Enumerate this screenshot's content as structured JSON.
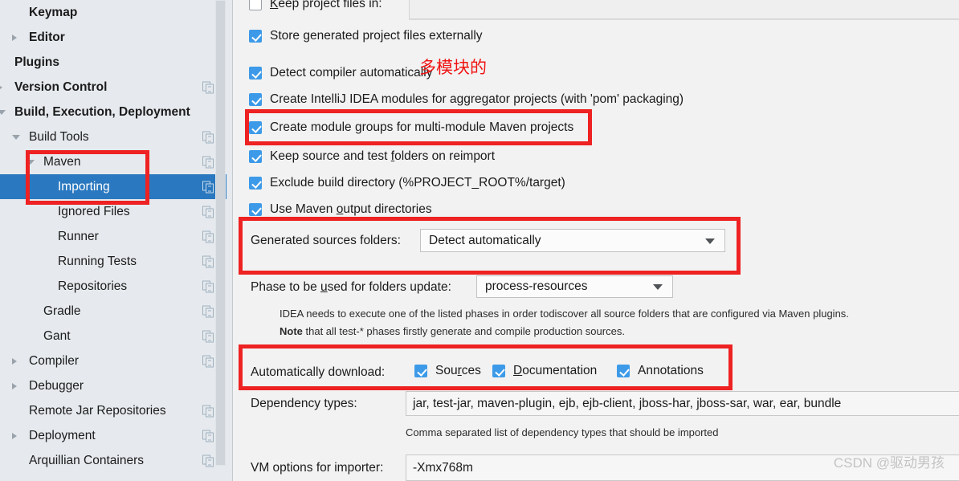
{
  "sidebar": {
    "items": [
      {
        "label": "Keymap",
        "indent": 36,
        "arrow": "none",
        "bold": true,
        "copy": false,
        "selected": false
      },
      {
        "label": "Editor",
        "indent": 36,
        "arrow": "right",
        "bold": true,
        "copy": false,
        "selected": false
      },
      {
        "label": "Plugins",
        "indent": 18,
        "arrow": "none",
        "bold": true,
        "copy": false,
        "selected": false
      },
      {
        "label": "Version Control",
        "indent": 18,
        "arrow": "right",
        "bold": true,
        "copy": true,
        "selected": false
      },
      {
        "label": "Build, Execution, Deployment",
        "indent": 18,
        "arrow": "down",
        "bold": true,
        "copy": false,
        "selected": false
      },
      {
        "label": "Build Tools",
        "indent": 36,
        "arrow": "down",
        "bold": false,
        "copy": true,
        "selected": false
      },
      {
        "label": "Maven",
        "indent": 54,
        "arrow": "down",
        "bold": false,
        "copy": true,
        "selected": false
      },
      {
        "label": "Importing",
        "indent": 72,
        "arrow": "none",
        "bold": false,
        "copy": true,
        "selected": true
      },
      {
        "label": "Ignored Files",
        "indent": 72,
        "arrow": "none",
        "bold": false,
        "copy": true,
        "selected": false
      },
      {
        "label": "Runner",
        "indent": 72,
        "arrow": "none",
        "bold": false,
        "copy": true,
        "selected": false
      },
      {
        "label": "Running Tests",
        "indent": 72,
        "arrow": "none",
        "bold": false,
        "copy": true,
        "selected": false
      },
      {
        "label": "Repositories",
        "indent": 72,
        "arrow": "none",
        "bold": false,
        "copy": true,
        "selected": false
      },
      {
        "label": "Gradle",
        "indent": 54,
        "arrow": "none",
        "bold": false,
        "copy": true,
        "selected": false
      },
      {
        "label": "Gant",
        "indent": 54,
        "arrow": "none",
        "bold": false,
        "copy": true,
        "selected": false
      },
      {
        "label": "Compiler",
        "indent": 36,
        "arrow": "right",
        "bold": false,
        "copy": true,
        "selected": false
      },
      {
        "label": "Debugger",
        "indent": 36,
        "arrow": "right",
        "bold": false,
        "copy": false,
        "selected": false
      },
      {
        "label": "Remote Jar Repositories",
        "indent": 36,
        "arrow": "none",
        "bold": false,
        "copy": true,
        "selected": false
      },
      {
        "label": "Deployment",
        "indent": 36,
        "arrow": "right",
        "bold": false,
        "copy": true,
        "selected": false
      },
      {
        "label": "Arquillian Containers",
        "indent": 36,
        "arrow": "none",
        "bold": false,
        "copy": true,
        "selected": false
      }
    ]
  },
  "content": {
    "keep_project_files": {
      "label_pre": "K",
      "label_underline": "K",
      "label": "Keep project files in:",
      "checked": false,
      "value": ""
    },
    "checkboxes": [
      {
        "label": "Store generated project files externally",
        "checked": true,
        "pre": "Store generated project files externally",
        "u": "",
        "post": ""
      },
      {
        "label": "Detect compiler automatically",
        "checked": true,
        "pre": "Detect compiler automatically",
        "u": "",
        "post": ""
      },
      {
        "label": "Create IntelliJ IDEA modules for aggregator projects (with 'pom' packaging)",
        "checked": true,
        "pre": "Create IntelliJ IDEA modules for aggregator projects (with 'pom' packaging)",
        "u": "",
        "post": ""
      },
      {
        "label": "Create module groups for multi-module Maven projects",
        "checked": true,
        "pre": "Create module ",
        "u": "g",
        "post": "roups for multi-module Maven projects"
      },
      {
        "label": "Keep source and test folders on reimport",
        "checked": true,
        "pre": "Keep source and test ",
        "u": "f",
        "post": "olders on reimport"
      },
      {
        "label": "Exclude build directory (%PROJECT_ROOT%/target)",
        "checked": true,
        "pre": "Exclude build directory (%PROJECT_ROOT%/target)",
        "u": "",
        "post": ""
      },
      {
        "label": "Use Maven output directories",
        "checked": true,
        "pre": "Use Maven ",
        "u": "o",
        "post": "utput directories"
      }
    ],
    "generated_sources": {
      "label": "Generated sources folders:",
      "value": "Detect automatically"
    },
    "phase_update": {
      "label_pre": "Phase to be ",
      "label_u": "u",
      "label_post": "sed for folders update:",
      "label": "Phase to be used for folders update:",
      "value": "process-resources"
    },
    "hint_line1": "IDEA needs to execute one of the listed phases in order todiscover all source folders that are configured via Maven plugins.",
    "hint_note_bold": "Note",
    "hint_line2": " that all test-* phases firstly generate and compile production sources.",
    "auto_download": {
      "label": "Automatically download:",
      "options": [
        {
          "label": "Sources",
          "pre": "Sou",
          "u": "r",
          "post": "ces",
          "checked": true
        },
        {
          "label": "Documentation",
          "pre": "",
          "u": "D",
          "post": "ocumentation",
          "checked": true
        },
        {
          "label": "Annotations",
          "pre": "Annotations",
          "u": "",
          "post": "",
          "checked": true
        }
      ]
    },
    "dependency_types": {
      "label": "Dependency types:",
      "value": "jar, test-jar, maven-plugin, ejb, ejb-client, jboss-har, jboss-sar, war, ear, bundle",
      "hint": "Comma separated list of dependency types that should be imported"
    },
    "vm_options": {
      "label": "VM options for importer:",
      "value": "-Xmx768m"
    }
  },
  "annotations": {
    "red_note": "多模块的",
    "red_color": "#ee2222"
  },
  "watermark": "CSDN @驱动男孩"
}
